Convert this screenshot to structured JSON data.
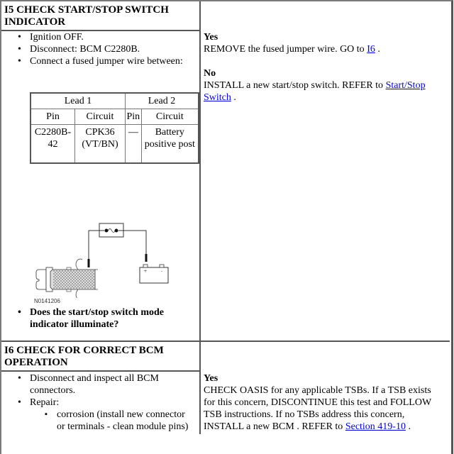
{
  "steps": [
    {
      "id": "I5",
      "title": "I5 CHECK START/STOP SWITCH INDICATOR",
      "actions": [
        "Ignition OFF.",
        "Disconnect: BCM C2280B.",
        "Connect a fused jumper wire between:"
      ],
      "lead_table": {
        "group_headers": [
          "Lead 1",
          "Lead 2"
        ],
        "column_headers": [
          "Pin",
          "Circuit",
          "Pin",
          "Circuit"
        ],
        "rows": [
          [
            "C2280B-42",
            "CPK36 (VT/BN)",
            "—",
            "Battery positive post"
          ]
        ]
      },
      "diagram": {
        "caption": "N0141206",
        "components": [
          "bcm-connector",
          "fused-jumper-wire",
          "battery"
        ],
        "battery_terminals": [
          "+",
          "-"
        ]
      },
      "question": "Does the start/stop switch mode indicator illuminate?",
      "responses": [
        {
          "label": "Yes",
          "text": "REMOVE the fused jumper wire. GO to ",
          "link": "I6",
          "after": "."
        },
        {
          "label": "No",
          "text": "INSTALL a new start/stop switch. REFER to ",
          "link": "Start/Stop Switch",
          "after": "."
        }
      ]
    },
    {
      "id": "I6",
      "title": "I6 CHECK FOR CORRECT BCM OPERATION",
      "actions": [
        "Disconnect and inspect all BCM connectors.",
        "Repair:"
      ],
      "sub_actions": [
        "corrosion (install new connector or terminals - clean module pins)"
      ],
      "responses": [
        {
          "label": "Yes",
          "text": "CHECK OASIS for any applicable TSBs. If a TSB exists for this concern, DISCONTINUE this test and FOLLOW TSB instructions. If no TSBs address this concern, INSTALL a new BCM . REFER to ",
          "link": "Section 419-10",
          "after": "."
        }
      ]
    }
  ],
  "colors": {
    "link": "#0000ee",
    "border": "#555555"
  }
}
